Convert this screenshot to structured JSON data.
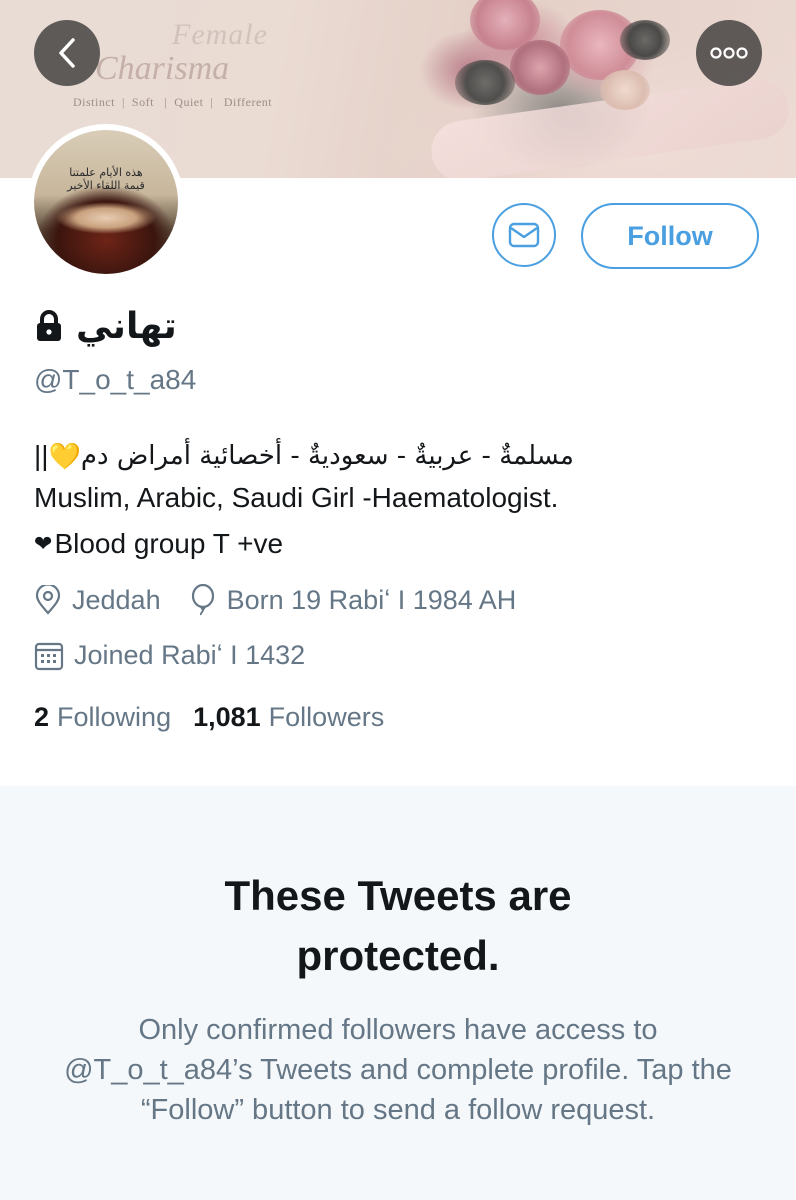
{
  "banner": {
    "title_line1": "Female",
    "title_line2": "Charisma",
    "tagline": "Distinct  |  Soft   |  Quiet  |   Different"
  },
  "navigation": {
    "back_icon": "chevron-left-icon",
    "more_icon": "more-dots-icon"
  },
  "avatar": {
    "text_line1": "هذه الأيام علمتنا",
    "text_line2": "قيمة اللقاء الأخير"
  },
  "actions": {
    "message_icon": "envelope-icon",
    "follow_label": "Follow"
  },
  "profile": {
    "display_name": "تهاني",
    "protected_icon": "lock-icon",
    "handle": "@T_o_t_a84",
    "bio_line1_arabic": "مسلمةٌ - عربيةٌ - سعوديةٌ - أخصائية أمراض دم",
    "bio_line1_emoji": "💛",
    "bio_line1_suffix": "||",
    "bio_line2": "Muslim, Arabic, Saudi Girl -Haematologist.",
    "bio_line3_heart": "❤",
    "bio_line3": "Blood group T +ve",
    "location": "Jeddah",
    "birthday": "Born 19 Rabiʻ I 1984 AH",
    "joined": "Joined Rabiʻ I 1432"
  },
  "stats": {
    "following_count": "2",
    "following_label": "Following",
    "followers_count": "1,081",
    "followers_label": "Followers"
  },
  "protected_notice": {
    "title_line1": "These Tweets are",
    "title_line2": "protected.",
    "description": "Only confirmed followers have access to @T_o_t_a84’s Tweets and complete profile. Tap the “Follow” button to send a follow request."
  },
  "colors": {
    "accent": "#4a9fe0",
    "secondary_text": "#657786",
    "primary_text": "#14171a",
    "notice_background": "#f5f8fa"
  }
}
